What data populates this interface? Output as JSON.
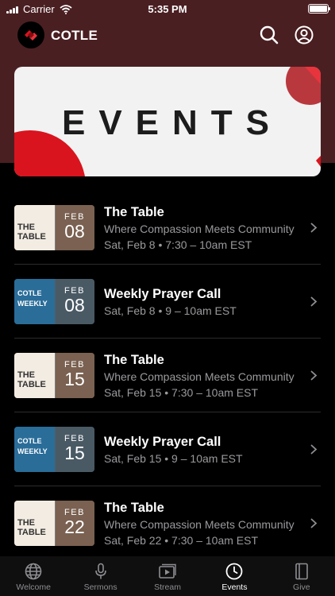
{
  "status_bar": {
    "carrier": "Carrier",
    "time": "5:35 PM"
  },
  "header": {
    "app_title": "COTLE",
    "search_icon": "search-icon",
    "account_icon": "account-icon"
  },
  "banner": {
    "title": "EVENTS"
  },
  "events": [
    {
      "title": "The Table",
      "subtitle": "Where Compassion Meets Community",
      "date_text": "Sat, Feb 8 • 7:30 – 10am EST",
      "thumb_month": "FEB",
      "thumb_day": "08",
      "thumb_art": "THE TABLE"
    },
    {
      "title": "Weekly Prayer Call",
      "subtitle": "",
      "date_text": "Sat, Feb 8 • 9 – 10am EST",
      "thumb_month": "FEB",
      "thumb_day": "08",
      "thumb_art": "COTLE WEEKLY"
    },
    {
      "title": "The Table",
      "subtitle": "Where Compassion Meets Community",
      "date_text": "Sat, Feb 15 • 7:30 – 10am EST",
      "thumb_month": "FEB",
      "thumb_day": "15",
      "thumb_art": "THE TABLE"
    },
    {
      "title": "Weekly Prayer Call",
      "subtitle": "",
      "date_text": "Sat, Feb 15 • 9 – 10am EST",
      "thumb_month": "FEB",
      "thumb_day": "15",
      "thumb_art": "COTLE WEEKLY"
    },
    {
      "title": "The Table",
      "subtitle": "Where Compassion Meets Community",
      "date_text": "Sat, Feb 22 • 7:30 – 10am EST",
      "thumb_month": "FEB",
      "thumb_day": "22",
      "thumb_art": "THE TABLE"
    }
  ],
  "tab_bar": {
    "tabs": [
      {
        "label": "Welcome",
        "icon": "globe-icon"
      },
      {
        "label": "Sermons",
        "icon": "microphone-icon"
      },
      {
        "label": "Stream",
        "icon": "play-stack-icon"
      },
      {
        "label": "Events",
        "icon": "clock-icon",
        "active": true
      },
      {
        "label": "Give",
        "icon": "book-icon"
      }
    ]
  },
  "colors": {
    "header_bg": "#4a1f22",
    "background": "#000000",
    "accent_red": "#d9141e",
    "table_orange": "#d9793a",
    "prayer_blue": "#1d5b86"
  }
}
